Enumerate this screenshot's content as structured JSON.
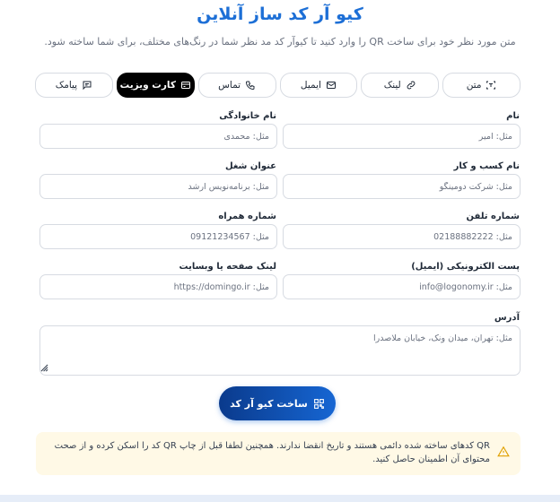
{
  "header": {
    "title": "کیو آر کد ساز آنلاین",
    "subtitle": "متن مورد نظر خود برای ساخت QR را وارد کنید تا کیوآر کد مد نظر شما در رنگ‌های مختلف، برای شما ساخته شود."
  },
  "tabs": [
    {
      "label": "متن",
      "icon": "text-scan-icon"
    },
    {
      "label": "لینک",
      "icon": "link-icon"
    },
    {
      "label": "ایمیل",
      "icon": "mail-icon"
    },
    {
      "label": "تماس",
      "icon": "phone-icon"
    },
    {
      "label": "کارت ویزیت",
      "icon": "card-icon",
      "active": true
    },
    {
      "label": "پیامک",
      "icon": "message-icon"
    }
  ],
  "form": {
    "first_name": {
      "label": "نام",
      "placeholder": "مثل: امیر"
    },
    "last_name": {
      "label": "نام خانوادگی",
      "placeholder": "مثل: محمدی"
    },
    "business": {
      "label": "نام کسب و کار",
      "placeholder": "مثل: شرکت دومینگو"
    },
    "job_title": {
      "label": "عنوان شغل",
      "placeholder": "مثل: برنامه‌نویس ارشد"
    },
    "phone": {
      "label": "شماره تلفن",
      "placeholder": "مثل: 02188882222"
    },
    "mobile": {
      "label": "شماره همراه",
      "placeholder": "مثل: 09121234567"
    },
    "email": {
      "label": "پست الکترونیکی (ایمیل)",
      "placeholder": "مثل: info@logonomy.ir"
    },
    "website": {
      "label": "لینک صفحه یا وبسایت",
      "placeholder": "مثل: https://domingo.ir"
    },
    "address": {
      "label": "آدرس",
      "placeholder": "مثل: تهران، میدان ونک، خیابان ملاصدرا"
    }
  },
  "generate_button": {
    "label": "ساخت کیو آر کد",
    "icon": "qr-code-icon"
  },
  "notice": {
    "icon": "warning-icon",
    "text": "QR کدهای ساخته شده دائمی هستند و تاریخ انقضا ندارند. همچنین لطفا قبل از چاپ QR کد را اسکن کرده و از صحت محتوای آن اطمینان حاصل کنید."
  },
  "colors": {
    "accent": "#1d6fd6",
    "button_gradient_start": "#0a3a8c",
    "button_gradient_end": "#1666d3",
    "notice_bg": "#fff9e6",
    "warning": "#e0a000"
  }
}
